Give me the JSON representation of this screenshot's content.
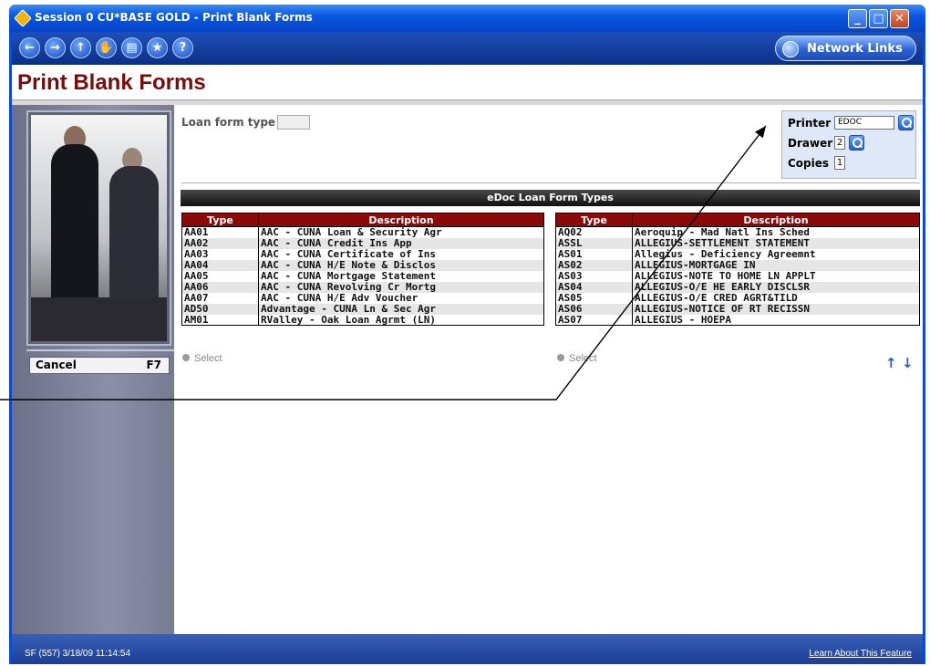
{
  "window": {
    "title": "Session 0 CU*BASE GOLD - Print Blank Forms",
    "minimize": "_",
    "maximize": "□",
    "close": "✕"
  },
  "toolbar": {
    "nav_icons": [
      "back-arrow-icon",
      "forward-arrow-icon",
      "up-arrow-icon",
      "stop-hand-icon",
      "print-icon",
      "favorites-star-icon",
      "help-icon"
    ],
    "back": "←",
    "forward": "→",
    "up": "↑",
    "hand": "✋",
    "print": "▤",
    "star": "★",
    "help": "?",
    "network_links": "Network Links"
  },
  "page": {
    "title": "Print Blank Forms",
    "loan_form_type_label": "Loan form type",
    "loan_form_type_value": ""
  },
  "printer": {
    "printer_label": "Printer",
    "printer_value": "EDOC",
    "drawer_label": "Drawer",
    "drawer_value": "2",
    "copies_label": "Copies",
    "copies_value": "1"
  },
  "grid": {
    "title": "eDoc Loan Form Types",
    "col_type": "Type",
    "col_description": "Description",
    "left_rows": [
      {
        "type": "AA01",
        "description": "AAC - CUNA Loan & Security Agr"
      },
      {
        "type": "AA02",
        "description": "AAC - CUNA Credit Ins App"
      },
      {
        "type": "AA03",
        "description": "AAC - CUNA Certificate of Ins"
      },
      {
        "type": "AA04",
        "description": "AAC - CUNA H/E Note & Disclos"
      },
      {
        "type": "AA05",
        "description": "AAC - CUNA Mortgage Statement"
      },
      {
        "type": "AA06",
        "description": "AAC - CUNA Revolving Cr Mortg"
      },
      {
        "type": "AA07",
        "description": "AAC - CUNA H/E Adv Voucher"
      },
      {
        "type": "AD50",
        "description": "Advantage - CUNA Ln & Sec Agr"
      },
      {
        "type": "AM01",
        "description": "RValley - Oak Loan Agrmt (LN)"
      }
    ],
    "right_rows": [
      {
        "type": "AQ02",
        "description": "Aeroquip - Mad Natl Ins Sched"
      },
      {
        "type": "ASSL",
        "description": "ALLEGIUS-SETTLEMENT STATEMENT"
      },
      {
        "type": "AS01",
        "description": "Allegius - Deficiency Agreemnt"
      },
      {
        "type": "AS02",
        "description": "ALLEGIUS-MORTGAGE IN"
      },
      {
        "type": "AS03",
        "description": "ALLEGIUS-NOTE TO HOME LN APPLT"
      },
      {
        "type": "AS04",
        "description": "ALLEGIUS-O/E HE EARLY DISCLSR"
      },
      {
        "type": "AS05",
        "description": "ALLEGIUS-O/E CRED AGRT&TILD"
      },
      {
        "type": "AS06",
        "description": "ALLEGIUS-NOTICE OF RT RECISSN"
      },
      {
        "type": "AS07",
        "description": "ALLEGIUS - HOEPA"
      }
    ],
    "select_label": "Select",
    "scroll_up": "↑",
    "scroll_down": "↓"
  },
  "sidebar": {
    "cancel_label": "Cancel",
    "cancel_key": "F7"
  },
  "status": {
    "left": "SF (557) 3/18/09 11:14:54",
    "right": "Learn About This Feature"
  },
  "colors": {
    "title_red": "#7a0c0c",
    "header_red": "#8a0a0a",
    "xp_blue": "#0a4bd3",
    "sidebar_gray": "#8b90a8"
  }
}
